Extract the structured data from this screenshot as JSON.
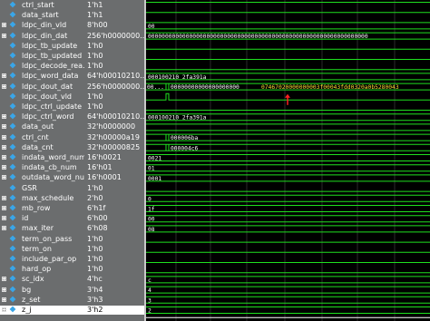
{
  "colors": {
    "panel_bg": "#6b6d6e",
    "wave_bg": "#000000",
    "wave_line": "#1fe01f",
    "cursor_line": "#ffffff",
    "marker": "#ff2020",
    "hex_text_highlight": "#ffdd33"
  },
  "signals": [
    {
      "name": "ctrl_start",
      "value": "1'h1",
      "expandable": false,
      "wave": {
        "kind": "bit",
        "level": 1,
        "segs": []
      }
    },
    {
      "name": "data_start",
      "value": "1'h1",
      "expandable": false,
      "wave": {
        "kind": "bit",
        "level": 1,
        "segs": []
      }
    },
    {
      "name": "ldpc_din_vld",
      "value": "8'h00",
      "expandable": true,
      "wave": {
        "kind": "bus",
        "text": "00"
      }
    },
    {
      "name": "ldpc_din_dat",
      "value": "256'h0000000...",
      "expandable": true,
      "wave": {
        "kind": "bus",
        "text": "0000000000000000000000000000000000000000000000000000000000000000"
      }
    },
    {
      "name": "ldpc_tb_update",
      "value": "1'h0",
      "expandable": false,
      "wave": {
        "kind": "bit",
        "level": 0
      }
    },
    {
      "name": "ldpc_tb_updated",
      "value": "1'h0",
      "expandable": false,
      "wave": {
        "kind": "bit",
        "level": 0
      }
    },
    {
      "name": "ldpc_decode_rea...",
      "value": "1'h0",
      "expandable": false,
      "wave": {
        "kind": "bit",
        "level": 0
      }
    },
    {
      "name": "ldpc_word_data",
      "value": "64'h00010210...",
      "expandable": true,
      "wave": {
        "kind": "bus",
        "text": "000100210 2fa391a"
      }
    },
    {
      "name": "ldpc_dout_dat",
      "value": "256'h0000000...",
      "expandable": true,
      "wave": {
        "kind": "bus2",
        "text_a": "00...",
        "text_b": "00000000000000000000",
        "text_c": "07467020000000003f00043fdd0320a0b5280043"
      }
    },
    {
      "name": "ldpc_dout_vld",
      "value": "1'h0",
      "expandable": false,
      "wave": {
        "kind": "pulse"
      }
    },
    {
      "name": "ldpc_ctrl_update",
      "value": "1'h0",
      "expandable": false,
      "wave": {
        "kind": "bit",
        "level": 0
      }
    },
    {
      "name": "ldpc_ctrl_word",
      "value": "64'h00010210...",
      "expandable": true,
      "wave": {
        "kind": "bus",
        "text": "000100210 2fa391a"
      }
    },
    {
      "name": "data_out",
      "value": "32'h0000000",
      "expandable": true,
      "wave": {
        "kind": "bus",
        "text": ""
      }
    },
    {
      "name": "ctrl_cnt",
      "value": "32'h00000a19",
      "expandable": true,
      "wave": {
        "kind": "bus3",
        "text": "000006ba"
      }
    },
    {
      "name": "data_cnt",
      "value": "32'h00000825",
      "expandable": true,
      "wave": {
        "kind": "bus3",
        "text": "000004c6"
      }
    },
    {
      "name": "indata_word_num",
      "value": "16'h0021",
      "expandable": true,
      "wave": {
        "kind": "bus",
        "text": "0021"
      }
    },
    {
      "name": "indata_cb_num",
      "value": "16'h01",
      "expandable": true,
      "wave": {
        "kind": "bus",
        "text": "01"
      }
    },
    {
      "name": "outdata_word_num",
      "value": "16'h0001",
      "expandable": true,
      "wave": {
        "kind": "bus",
        "text": "0001"
      }
    },
    {
      "name": "GSR",
      "value": "1'h0",
      "expandable": false,
      "wave": {
        "kind": "bit",
        "level": 0
      }
    },
    {
      "name": "max_schedule",
      "value": "2'h0",
      "expandable": true,
      "wave": {
        "kind": "bus",
        "text": "0"
      }
    },
    {
      "name": "mb_row",
      "value": "6'h1f",
      "expandable": true,
      "wave": {
        "kind": "bus",
        "text": "1f"
      }
    },
    {
      "name": "id",
      "value": "6'h00",
      "expandable": true,
      "wave": {
        "kind": "bus",
        "text": "00"
      }
    },
    {
      "name": "max_iter",
      "value": "6'h08",
      "expandable": true,
      "wave": {
        "kind": "bus",
        "text": "08"
      }
    },
    {
      "name": "term_on_pass",
      "value": "1'h0",
      "expandable": false,
      "wave": {
        "kind": "bit",
        "level": 0
      }
    },
    {
      "name": "term_on",
      "value": "1'h0",
      "expandable": false,
      "wave": {
        "kind": "bit",
        "level": 0
      }
    },
    {
      "name": "include_par_op",
      "value": "1'h0",
      "expandable": false,
      "wave": {
        "kind": "bit",
        "level": 0
      }
    },
    {
      "name": "hard_op",
      "value": "1'h0",
      "expandable": false,
      "wave": {
        "kind": "bit",
        "level": 0
      }
    },
    {
      "name": "sc_idx",
      "value": "4'hc",
      "expandable": true,
      "wave": {
        "kind": "bus",
        "text": "c"
      }
    },
    {
      "name": "bg",
      "value": "3'h4",
      "expandable": true,
      "wave": {
        "kind": "bus",
        "text": "4"
      }
    },
    {
      "name": "z_set",
      "value": "3'h3",
      "expandable": true,
      "wave": {
        "kind": "bus",
        "text": "3"
      }
    },
    {
      "name": "z_j",
      "value": "3'h2",
      "expandable": true,
      "selected": true,
      "wave": {
        "kind": "bus",
        "text": "2"
      }
    }
  ]
}
